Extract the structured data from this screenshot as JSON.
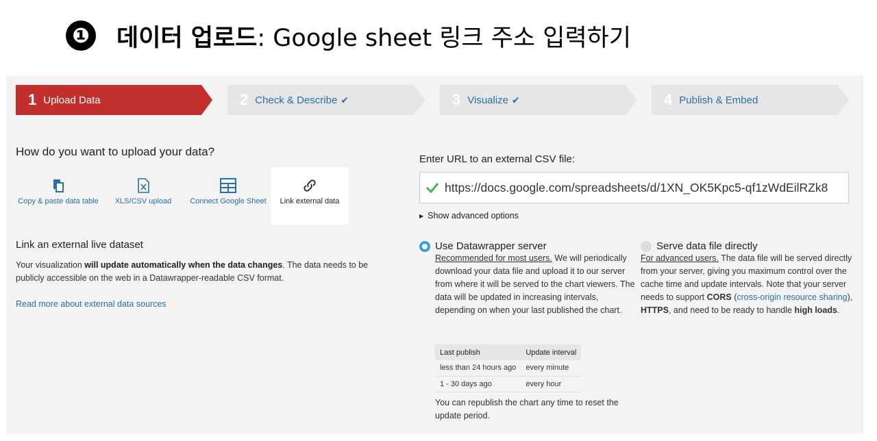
{
  "header": {
    "number": "❶",
    "title_bold": "데이터 업로드",
    "title_rest": ": Google sheet 링크 주소 입력하기"
  },
  "steps": [
    {
      "num": "1",
      "label": "Upload Data",
      "check": ""
    },
    {
      "num": "2",
      "label": "Check & Describe",
      "check": "✔"
    },
    {
      "num": "3",
      "label": "Visualize",
      "check": "✔"
    },
    {
      "num": "4",
      "label": "Publish & Embed",
      "check": ""
    }
  ],
  "colors": {
    "active_step": "#c1302d",
    "inactive_step": "#e6e6e6",
    "link": "#2a6fa8",
    "radio_on": "#39a0d9",
    "check_ok": "#4caf50"
  },
  "upload": {
    "question": "How do you want to upload your data?",
    "options": [
      {
        "label": "Copy & paste data table",
        "icon": "clipboard-icon"
      },
      {
        "label": "XLS/CSV upload",
        "icon": "spreadsheet-file-icon"
      },
      {
        "label": "Connect Google Sheet",
        "icon": "table-grid-icon"
      },
      {
        "label": "Link external data",
        "icon": "link-icon"
      }
    ]
  },
  "external": {
    "title": "Link an external live dataset",
    "desc_pre": "Your visualization ",
    "desc_bold": "will update automatically when the data changes",
    "desc_post": ". The data needs to be publicly accessible on the web in a Datawrapper-readable CSV format.",
    "read_more": "Read more about external data sources"
  },
  "url": {
    "label": "Enter URL to an external CSV file:",
    "value": "https://docs.google.com/spreadsheets/d/1XN_OK5Kpc5-qf1zWdEilRZk8"
  },
  "advanced": "Show advanced options",
  "server": {
    "heading": "Use Datawrapper server",
    "underline": "Recommended for most users.",
    "body": " We will periodically download your data file and upload it to our server from where it will be served to the chart viewers. The data will be updated in increasing intervals, depending on when your last published the chart.",
    "table_headers": [
      "Last publish",
      "Update interval"
    ],
    "table_rows": [
      [
        "less than 24 hours ago",
        "every minute"
      ],
      [
        "1 - 30 days ago",
        "every hour"
      ]
    ],
    "republish": "You can republish the chart any time to reset the update period."
  },
  "direct": {
    "heading": "Serve data file directly",
    "underline": "For advanced users.",
    "body1": " The data file will be served directly from your server, giving you maximum control over the cache time and update intervals. Note that your server needs to support ",
    "cors": "CORS",
    "paren_open": " (",
    "cors_link": "cross-origin resource sharing",
    "paren_close": "), ",
    "https": "HTTPS",
    "body2": ", and need to be ready to handle ",
    "high_loads": "high loads",
    "period": "."
  }
}
